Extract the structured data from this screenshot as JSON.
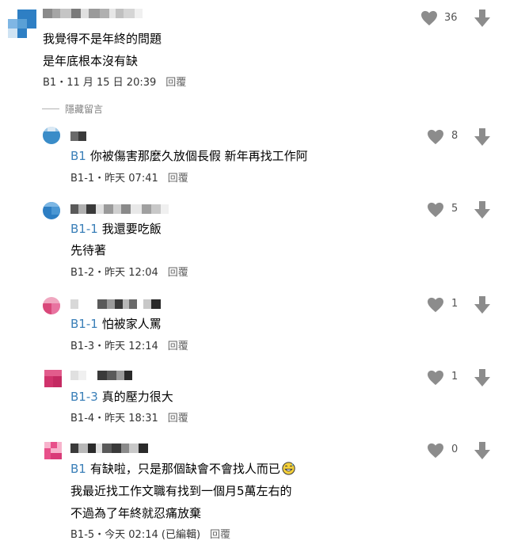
{
  "colors": {
    "reference": "#3a7fb8",
    "icon": "#8c8c8c",
    "meta_text": "#333333",
    "reply_text": "#666666"
  },
  "hidden_replies_label": "隱藏留言",
  "comments": [
    {
      "id": "B1",
      "avatar_colors": [
        "#2e7fc4",
        "#7fb6e4",
        "#ffffff"
      ],
      "content": [
        {
          "ref": "",
          "text": "我覺得不是年終的問題"
        },
        {
          "ref": "",
          "text": "是年底根本沒有缺"
        }
      ],
      "meta": "B1・11 月 15 日 20:39",
      "reply_label": "回覆",
      "like_count": "36"
    },
    {
      "id": "B1-1",
      "avatar_colors": [
        "#3a8cc8",
        "#9fc9e8",
        "#5aa0d6"
      ],
      "content": [
        {
          "ref": "B1",
          "text": "你被傷害那麼久放個長假 新年再找工作阿"
        }
      ],
      "meta": "B1-1・昨天 07:41",
      "reply_label": "回覆",
      "like_count": "8"
    },
    {
      "id": "B1-2",
      "avatar_colors": [
        "#2d7ec3",
        "#4b97d3",
        "#7db7e4"
      ],
      "content": [
        {
          "ref": "B1-1",
          "text": "我還要吃飯"
        },
        {
          "ref": "",
          "text": "先待著"
        }
      ],
      "meta": "B1-2・昨天 12:04",
      "reply_label": "回覆",
      "like_count": "5"
    },
    {
      "id": "B1-3",
      "avatar_colors": [
        "#d9487a",
        "#f0a7c0",
        "#e873a0"
      ],
      "content": [
        {
          "ref": "B1-1",
          "text": "怕被家人罵"
        }
      ],
      "meta": "B1-3・昨天 12:14",
      "reply_label": "回覆",
      "like_count": "1"
    },
    {
      "id": "B1-4",
      "avatar_colors": [
        "#d0336c",
        "#e25c8c",
        "#c42a62"
      ],
      "content": [
        {
          "ref": "B1-3",
          "text": "真的壓力很大"
        }
      ],
      "meta": "B1-4・昨天 18:31",
      "reply_label": "回覆",
      "like_count": "1"
    },
    {
      "id": "B1-5",
      "avatar_colors": [
        "#e8508a",
        "#f7b3cc",
        "#d93b78"
      ],
      "content": [
        {
          "ref": "B1",
          "text": "有缺啦，只是那個缺會不會找人而已"
        },
        {
          "ref": "",
          "text": "我最近找工作文職有找到一個月5萬左右的"
        },
        {
          "ref": "",
          "text": "不過為了年終就忍痛放棄"
        }
      ],
      "meta": "B1-5・今天 02:14 (已編輯)",
      "reply_label": "回覆",
      "like_count": "0"
    }
  ]
}
